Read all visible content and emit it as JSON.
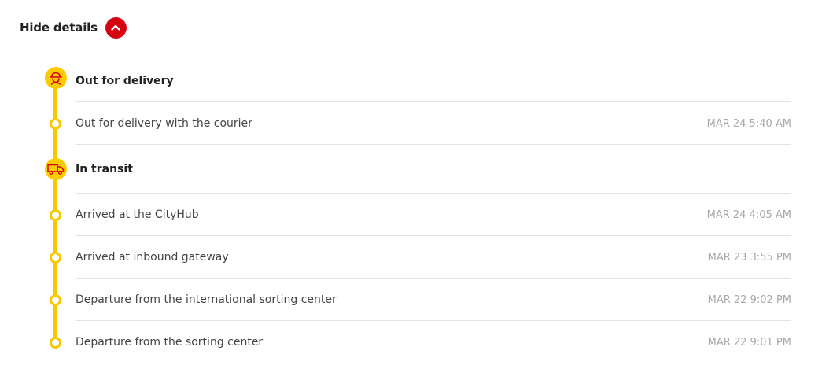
{
  "header": {
    "toggle_label": "Hide details",
    "toggle_icon": "chevron-up-icon"
  },
  "colors": {
    "accent_red": "#d40511",
    "timeline_yellow": "#f7c800",
    "icon_red": "#d40511"
  },
  "groups": [
    {
      "title": "Out for delivery",
      "icon": "courier-icon",
      "events": [
        {
          "text": "Out for delivery with the courier",
          "time": "MAR 24 5:40 AM"
        }
      ]
    },
    {
      "title": "In transit",
      "icon": "truck-icon",
      "events": [
        {
          "text": "Arrived at the CityHub",
          "time": "MAR 24 4:05 AM"
        },
        {
          "text": "Arrived at inbound gateway",
          "time": "MAR 23 3:55 PM"
        },
        {
          "text": "Departure from the international sorting center",
          "time": "MAR 22 9:02 PM"
        },
        {
          "text": "Departure from the sorting center",
          "time": "MAR 22 9:01 PM"
        }
      ]
    }
  ]
}
